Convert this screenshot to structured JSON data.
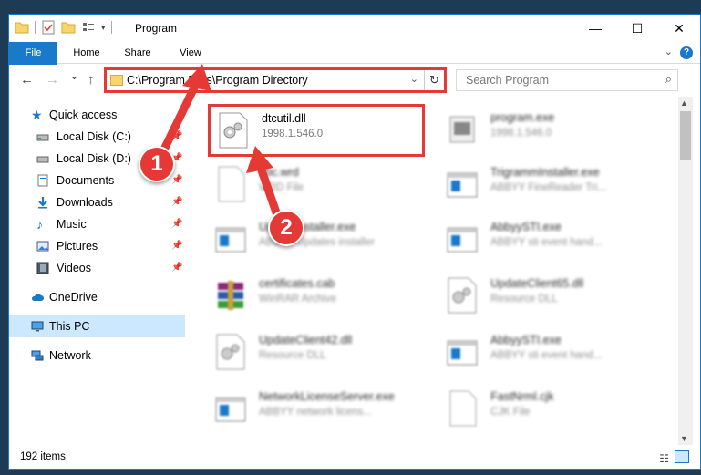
{
  "window": {
    "title": "Program",
    "controls": {
      "minimize": "—",
      "maximize": "☐",
      "close": "✕"
    }
  },
  "ribbon": {
    "tabs": [
      {
        "label": "File"
      },
      {
        "label": "Home"
      },
      {
        "label": "Share"
      },
      {
        "label": "View"
      }
    ],
    "help": "?"
  },
  "nav": {
    "back": "←",
    "forward": "→",
    "recent": "⌄",
    "up": "↑",
    "address": "C:\\Program Files\\Program Directory",
    "search_placeholder": "Search Program"
  },
  "sidebar": {
    "items": [
      {
        "label": "Quick access",
        "icon": "star-icon",
        "pinned": false
      },
      {
        "label": "Local Disk (C:)",
        "icon": "drive-icon",
        "pinned": true
      },
      {
        "label": "Local Disk (D:)",
        "icon": "drive-icon",
        "pinned": true
      },
      {
        "label": "Documents",
        "icon": "documents-icon",
        "pinned": true
      },
      {
        "label": "Downloads",
        "icon": "download-icon",
        "pinned": true
      },
      {
        "label": "Music",
        "icon": "music-icon",
        "pinned": true
      },
      {
        "label": "Pictures",
        "icon": "pictures-icon",
        "pinned": true
      },
      {
        "label": "Videos",
        "icon": "videos-icon",
        "pinned": true
      },
      {
        "label": "OneDrive",
        "icon": "cloud-icon",
        "pinned": false
      },
      {
        "label": "This PC",
        "icon": "computer-icon",
        "pinned": false,
        "selected": true
      },
      {
        "label": "Network",
        "icon": "network-icon",
        "pinned": false
      }
    ]
  },
  "files": [
    {
      "name": "dtcutil.dll",
      "sub": "1998.1.546.0",
      "icon": "dll-gear-icon",
      "highlighted": true
    },
    {
      "name": "program.exe",
      "sub": "1998.1.546.0",
      "icon": "exe-icon"
    },
    {
      "name": "abc.wrd",
      "sub": "WRD File",
      "icon": "blank-file-icon"
    },
    {
      "name": "TrigrammInstaller.exe",
      "sub": "ABBYY FineReader Tri...",
      "icon": "window-app-icon"
    },
    {
      "name": "Updatelnstaller.exe",
      "sub": "ABBYY Updates installer",
      "icon": "window-app-icon"
    },
    {
      "name": "AbbyySTI.exe",
      "sub": "ABBYY sti event hand...",
      "icon": "window-app-icon"
    },
    {
      "name": "certificates.cab",
      "sub": "WinRAR Archive",
      "icon": "winrar-icon"
    },
    {
      "name": "UpdateClient65.dll",
      "sub": "Resource DLL",
      "icon": "dll-gear-icon"
    },
    {
      "name": "UpdateClient42.dll",
      "sub": "Resource DLL",
      "icon": "dll-gear-icon"
    },
    {
      "name": "AbbyySTI.exe",
      "sub": "ABBYY sti event hand...",
      "icon": "window-app-icon"
    },
    {
      "name": "NetworkLicenseServer.exe",
      "sub": "ABBYY network licens...",
      "icon": "window-app-icon"
    },
    {
      "name": "FastNrml.cjk",
      "sub": "CJK File",
      "icon": "blank-file-icon"
    }
  ],
  "status": {
    "item_count": "192 items"
  },
  "annotations": {
    "step1": "1",
    "step2": "2",
    "color": "#e53935"
  }
}
